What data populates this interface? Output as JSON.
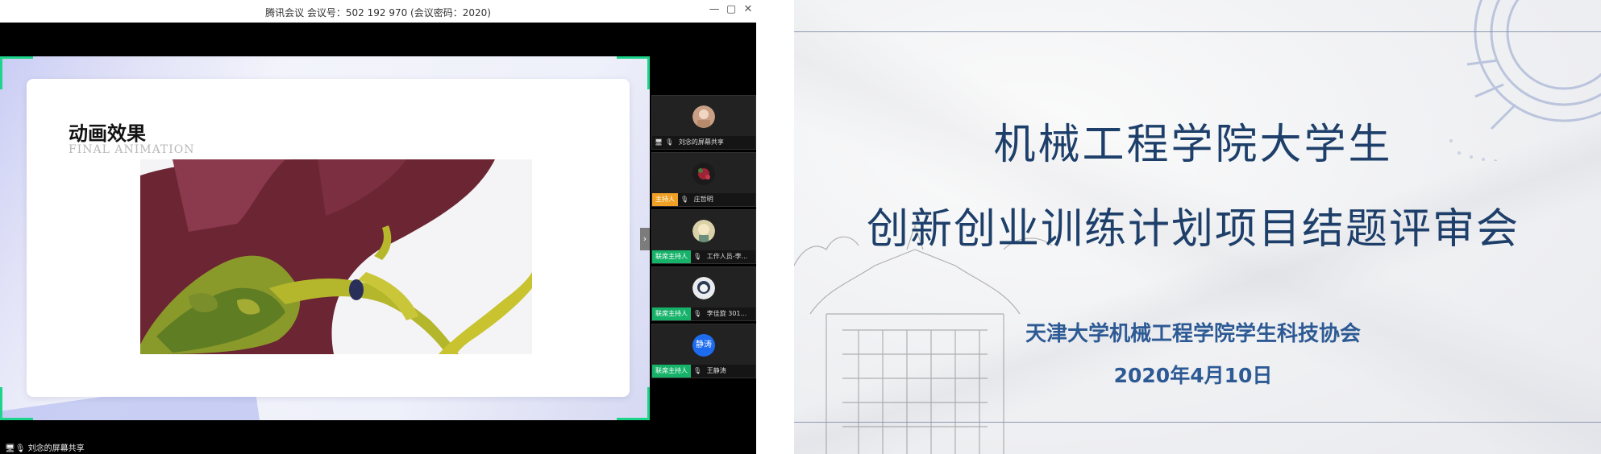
{
  "window": {
    "title": "腾讯会议 会议号：502 192 970  (会议密码：2020)",
    "controls": {
      "minimize": "—",
      "restore": "▢",
      "close": "✕"
    }
  },
  "shared_slide": {
    "title": "动画效果",
    "subtitle": "FINAL ANIMATION"
  },
  "participants": [
    {
      "name": "刘念的屏幕共享",
      "badge": "",
      "avatar": "photo-avatar",
      "sharing": true
    },
    {
      "name": "庄哲明",
      "badge": "主持人",
      "badge_type": "host",
      "avatar": "flower-avatar"
    },
    {
      "name": "工作人员-李...",
      "badge": "联席主持人",
      "badge_type": "co",
      "avatar": "cartoon-avatar"
    },
    {
      "name": "李佳旋 301...",
      "badge": "联席主持人",
      "badge_type": "co",
      "avatar": "anime-avatar"
    },
    {
      "name": "王静涛",
      "badge": "联席主持人",
      "badge_type": "co",
      "avatar_text": "静涛",
      "avatar_color": "#1d6cf0"
    }
  ],
  "bottom_label": "刘念的屏幕共享",
  "collapse_toggle": "›",
  "right_slide": {
    "title_line1": "机械工程学院大学生",
    "title_line2": "创新创业训练计划项目结题评审会",
    "organizer": "天津大学机械工程学院学生科技协会",
    "date": "2020年4月10日"
  }
}
